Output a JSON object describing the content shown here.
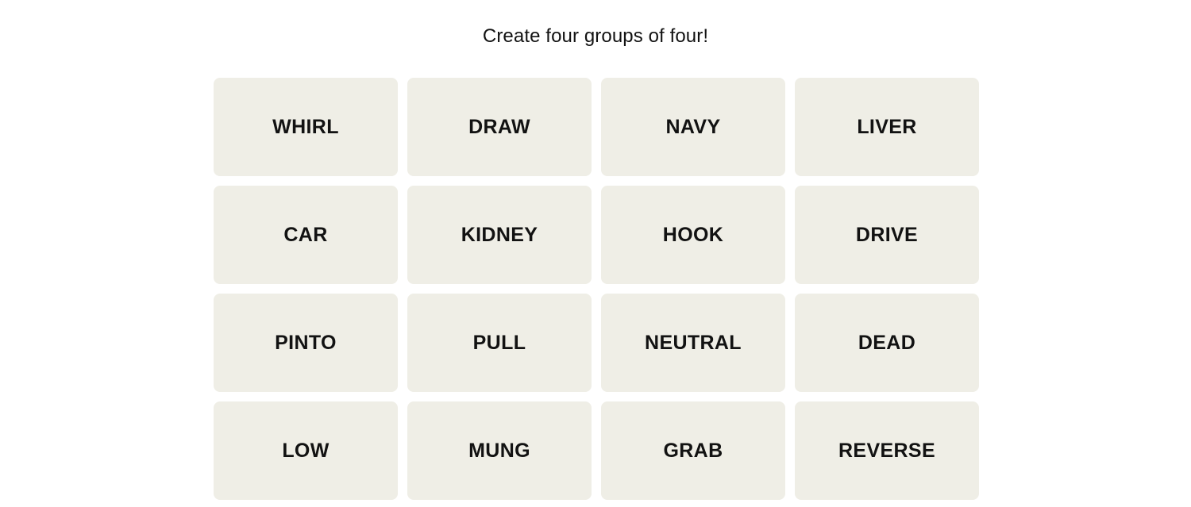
{
  "page": {
    "background_color": "#ffffff",
    "text_color": "#121212"
  },
  "instruction": {
    "text": "Create four groups of four!"
  },
  "board": {
    "rows": 4,
    "columns": 4,
    "tile_color": "#efeee6",
    "tile_text_color": "#121212",
    "tiles": [
      {
        "label": "WHIRL",
        "row": 1,
        "column": 1,
        "selected": false
      },
      {
        "label": "DRAW",
        "row": 1,
        "column": 2,
        "selected": false
      },
      {
        "label": "NAVY",
        "row": 1,
        "column": 3,
        "selected": false
      },
      {
        "label": "LIVER",
        "row": 1,
        "column": 4,
        "selected": false
      },
      {
        "label": "CAR",
        "row": 2,
        "column": 1,
        "selected": false
      },
      {
        "label": "KIDNEY",
        "row": 2,
        "column": 2,
        "selected": false
      },
      {
        "label": "HOOK",
        "row": 2,
        "column": 3,
        "selected": false
      },
      {
        "label": "DRIVE",
        "row": 2,
        "column": 4,
        "selected": false
      },
      {
        "label": "PINTO",
        "row": 3,
        "column": 1,
        "selected": false
      },
      {
        "label": "PULL",
        "row": 3,
        "column": 2,
        "selected": false
      },
      {
        "label": "NEUTRAL",
        "row": 3,
        "column": 3,
        "selected": false
      },
      {
        "label": "DEAD",
        "row": 3,
        "column": 4,
        "selected": false
      },
      {
        "label": "LOW",
        "row": 4,
        "column": 1,
        "selected": false
      },
      {
        "label": "MUNG",
        "row": 4,
        "column": 2,
        "selected": false
      },
      {
        "label": "GRAB",
        "row": 4,
        "column": 3,
        "selected": false
      },
      {
        "label": "REVERSE",
        "row": 4,
        "column": 4,
        "selected": false
      }
    ]
  }
}
